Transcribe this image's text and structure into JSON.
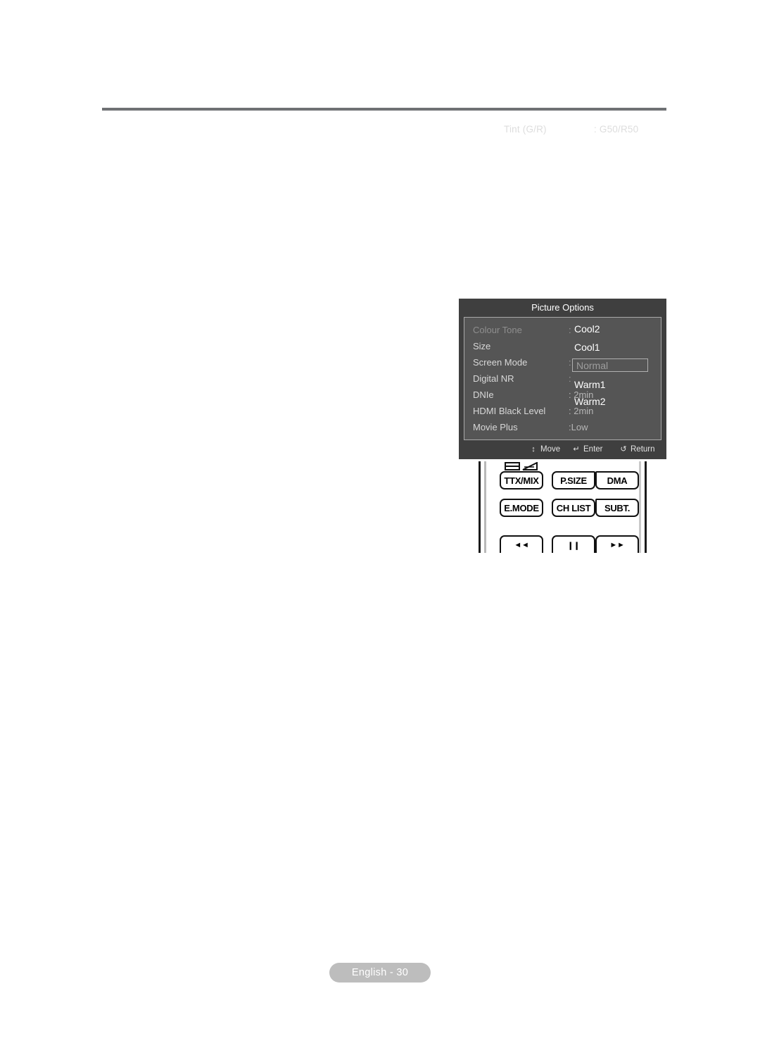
{
  "header": {
    "note_label": "Tint (G/R)",
    "note_value": ": G50/R50"
  },
  "osd": {
    "title": "Picture Options",
    "rows": [
      {
        "label": "Colour Tone",
        "colon": ":",
        "value": ""
      },
      {
        "label": "Size",
        "colon": "",
        "value": ""
      },
      {
        "label": "Screen Mode",
        "colon": ":",
        "value": ""
      },
      {
        "label": "Digital NR",
        "colon": ":",
        "value": ""
      },
      {
        "label": "DNIe",
        "colon": "",
        "value": ": 2min"
      },
      {
        "label": "HDMI Black Level",
        "colon": "",
        "value": ": 2min"
      },
      {
        "label": "Movie Plus",
        "colon": "",
        "value": ":Low"
      }
    ],
    "dropdown": {
      "name": "colour-tone-options",
      "items": [
        "Cool2",
        "Cool1",
        "Normal",
        "Warm1",
        "Warm2"
      ],
      "selected": "Normal"
    },
    "footer": {
      "move": "Move",
      "enter": "Enter",
      "return": "Return",
      "move_icon": "↕",
      "enter_icon": "↵",
      "return_icon": "↺"
    }
  },
  "remote": {
    "buttons": [
      {
        "label": "TTX/MIX"
      },
      {
        "label": "P.SIZE"
      },
      {
        "label": "DMA"
      },
      {
        "label": "E.MODE"
      },
      {
        "label": "CH LIST"
      },
      {
        "label": "SUBT."
      }
    ],
    "partial_buttons": [
      {
        "label": "◄◄"
      },
      {
        "label": "❙❙"
      },
      {
        "label": "►►"
      }
    ]
  },
  "footer": {
    "page_badge": "English - 30"
  },
  "colors": {
    "panel_bar": "#3f3f3f",
    "panel_body": "#555555",
    "rule": "#6f7174",
    "badge": "#bdbdbd"
  }
}
